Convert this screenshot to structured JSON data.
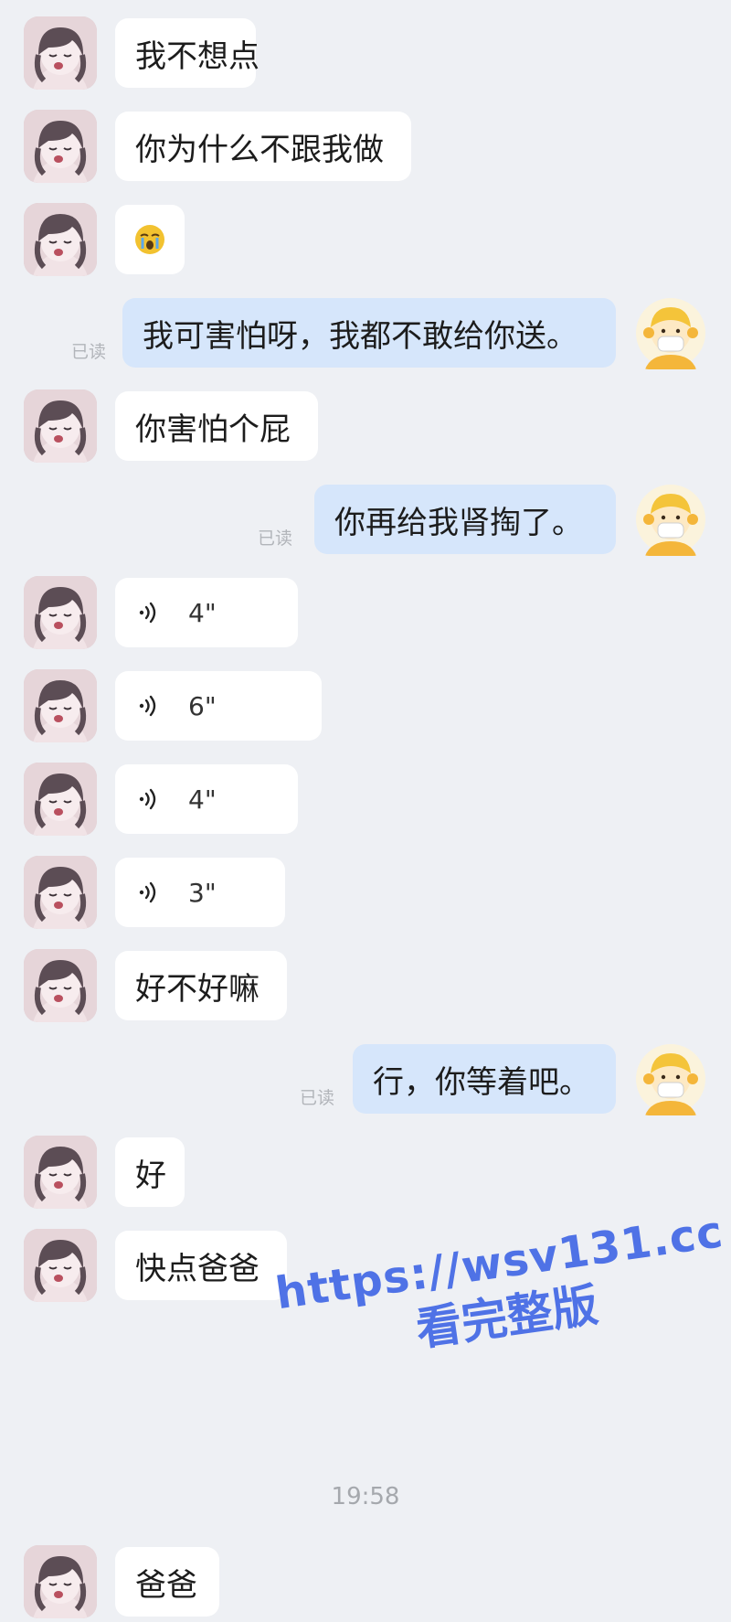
{
  "messages": [
    {
      "side": "in",
      "type": "text",
      "text": "我不想点"
    },
    {
      "side": "in",
      "type": "text",
      "text": "你为什么不跟我做"
    },
    {
      "side": "in",
      "type": "emoji",
      "emoji": "crying-face-icon"
    },
    {
      "side": "out",
      "type": "text",
      "text": "我可害怕呀，我都不敢给你送。",
      "read": "已读"
    },
    {
      "side": "in",
      "type": "text",
      "text": "你害怕个屁"
    },
    {
      "side": "out",
      "type": "text",
      "text": "你再给我肾掏了。",
      "read": "已读"
    },
    {
      "side": "in",
      "type": "voice",
      "duration": "4\""
    },
    {
      "side": "in",
      "type": "voice",
      "duration": "6\""
    },
    {
      "side": "in",
      "type": "voice",
      "duration": "4\""
    },
    {
      "side": "in",
      "type": "voice",
      "duration": "3\""
    },
    {
      "side": "in",
      "type": "text",
      "text": "好不好嘛"
    },
    {
      "side": "out",
      "type": "text",
      "text": "行，你等着吧。",
      "read": "已读"
    },
    {
      "side": "in",
      "type": "text",
      "text": "好"
    },
    {
      "side": "in",
      "type": "text",
      "text": "快点爸爸"
    },
    {
      "side": "in",
      "type": "text",
      "text": "爸爸"
    }
  ],
  "timestamp": "19:58",
  "watermark": {
    "url": "https://wsv131.cc",
    "text": "看完整版"
  },
  "colors": {
    "background": "#eef0f4",
    "incoming_bubble": "#ffffff",
    "outgoing_bubble": "#d6e6fb",
    "watermark": "#4f72e6",
    "read_label": "#b2b5ba"
  },
  "icons": {
    "incoming_avatar": "girl-avatar",
    "outgoing_avatar": "masked-person-avatar",
    "voice": "voice-wave-icon"
  }
}
